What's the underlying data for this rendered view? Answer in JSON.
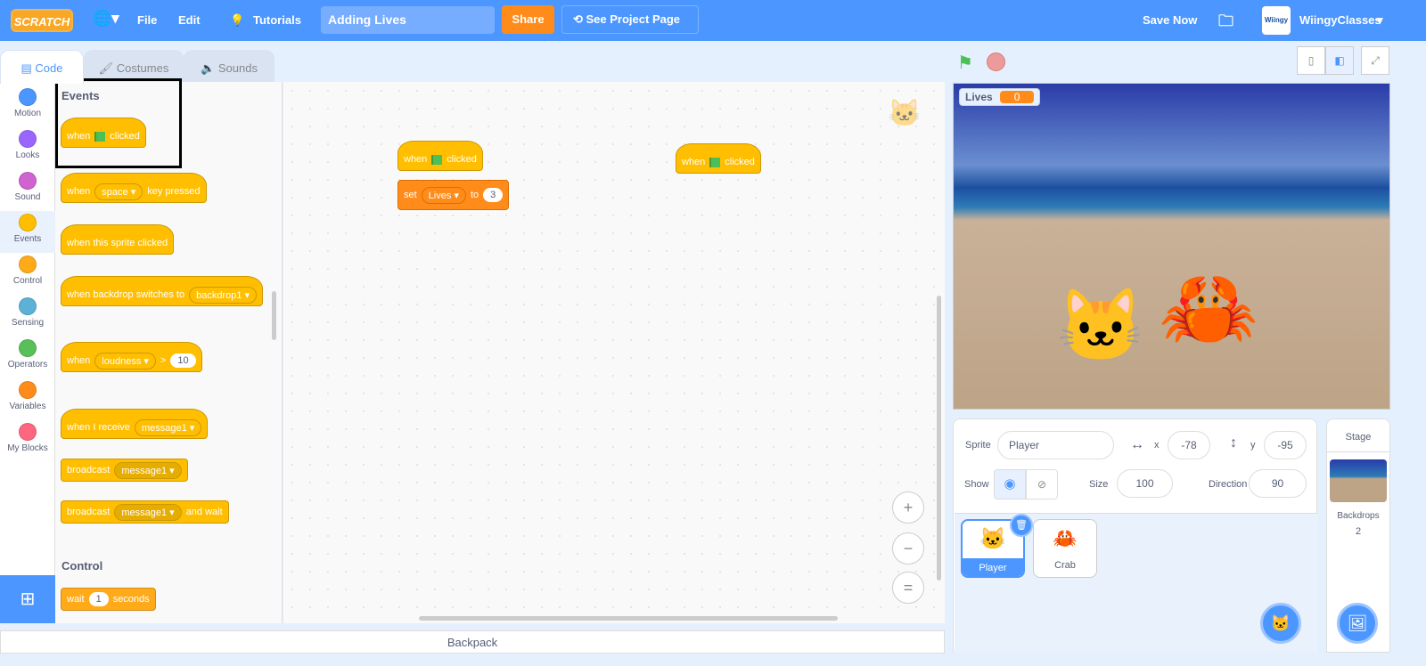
{
  "menu": {
    "logo": "SCRATCH",
    "file": "File",
    "edit": "Edit",
    "tutorials": "Tutorials",
    "project_title": "Adding Lives",
    "share": "Share",
    "see_project": "See Project Page",
    "save_now": "Save Now",
    "username": "WiingyClasses"
  },
  "tabs": {
    "code": "Code",
    "costumes": "Costumes",
    "sounds": "Sounds"
  },
  "categories": [
    {
      "label": "Motion",
      "color": "#4C97FF"
    },
    {
      "label": "Looks",
      "color": "#9966FF"
    },
    {
      "label": "Sound",
      "color": "#CF63CF"
    },
    {
      "label": "Events",
      "color": "#FFBF00"
    },
    {
      "label": "Control",
      "color": "#FFAB19"
    },
    {
      "label": "Sensing",
      "color": "#5CB1D6"
    },
    {
      "label": "Operators",
      "color": "#59C059"
    },
    {
      "label": "Variables",
      "color": "#FF8C1A"
    },
    {
      "label": "My Blocks",
      "color": "#FF6680"
    }
  ],
  "palette": {
    "events_heading": "Events",
    "when": "when",
    "clicked": "clicked",
    "space": "space",
    "key_pressed": "key pressed",
    "when_sprite_clicked": "when this sprite clicked",
    "when_backdrop": "when backdrop switches to",
    "backdrop1": "backdrop1",
    "loudness": "loudness",
    "gt": ">",
    "ten": "10",
    "when_receive": "when I receive",
    "message1": "message1",
    "broadcast": "broadcast",
    "and_wait": "and wait",
    "control_heading": "Control",
    "wait": "wait",
    "one": "1",
    "seconds": "seconds"
  },
  "workspace": {
    "set": "set",
    "lives": "Lives",
    "to": "to",
    "value": "3"
  },
  "backpack": "Backpack",
  "stage": {
    "monitor_label": "Lives",
    "monitor_value": "0"
  },
  "sprite_info": {
    "sprite_label": "Sprite",
    "sprite_name": "Player",
    "x_label": "x",
    "x": "-78",
    "y_label": "y",
    "y": "-95",
    "show_label": "Show",
    "size_label": "Size",
    "size": "100",
    "direction_label": "Direction",
    "direction": "90"
  },
  "sprites": [
    {
      "name": "Player",
      "selected": true
    },
    {
      "name": "Crab",
      "selected": false
    }
  ],
  "stage_selector": {
    "title": "Stage",
    "backdrops_label": "Backdrops",
    "backdrops_count": "2"
  }
}
